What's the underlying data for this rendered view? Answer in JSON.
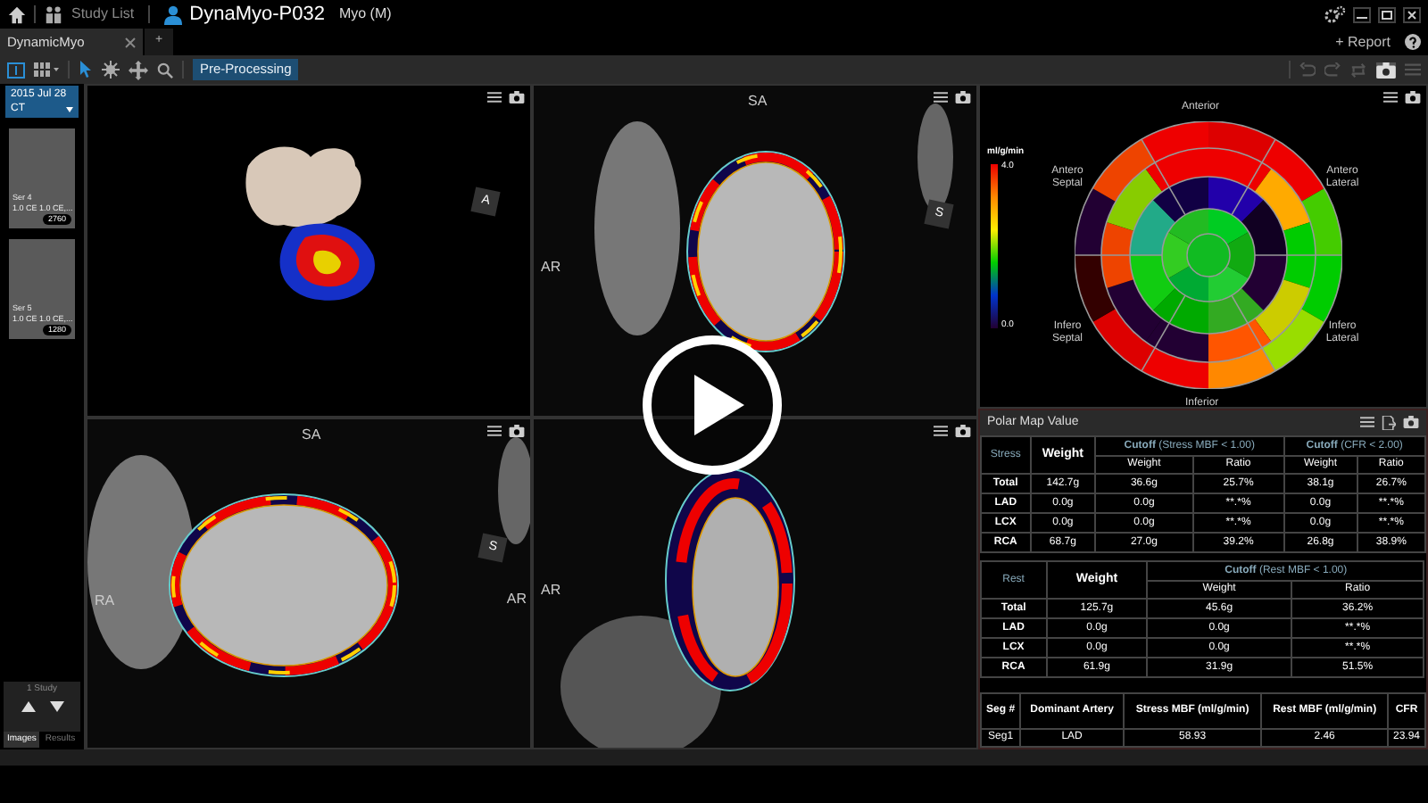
{
  "app_bar": {
    "study_list": "Study List",
    "patient_name": "DynaMyo-P032",
    "patient_info": "Myo (M)",
    "report": "+ Report"
  },
  "tabs": [
    {
      "label": "DynamicMyo",
      "selected": true
    }
  ],
  "new_tab": "+",
  "toolbar": {
    "mode_button": "Pre-Processing"
  },
  "sidebar": {
    "study": {
      "date": "2015 Jul 28",
      "modality": "CT"
    },
    "series": [
      {
        "name": "Ser 4",
        "description": "1.0 CE 1.0 CE,...",
        "count": "2760"
      },
      {
        "name": "Ser 5",
        "description": "1.0 CE 1.0 CE,...",
        "count": "1280"
      }
    ],
    "study_count": "1 Study",
    "tabs": [
      {
        "label": "Images",
        "selected": true
      },
      {
        "label": "Results",
        "selected": false
      }
    ]
  },
  "viewports": [
    {
      "kind": "volume",
      "cube_label": "A"
    },
    {
      "kind": "slice",
      "top_label": "SA",
      "left_label": "AR",
      "cube_label": "S"
    },
    {
      "kind": "slice",
      "top_label": "SA",
      "left_label": "RA",
      "right_label": "AR",
      "cube_label": "S"
    },
    {
      "kind": "long_axis",
      "left_label": "AR"
    }
  ],
  "polar_map": {
    "unit": "ml/g/min",
    "max": "4.0",
    "min": "0.0",
    "anterior": "Anterior",
    "antero_septal": "Antero Septal",
    "antero_lateral": "Antero Lateral",
    "infero_septal": "Infero Septal",
    "infero_lateral": "Infero Lateral",
    "inferior": "Inferior"
  },
  "polar_map_value": {
    "title": "Polar Map Value",
    "stress": {
      "heading": "Stress",
      "weight": "Weight",
      "cutoffs": [
        "**Cutoff** (Stress MBF < 1.00)",
        "**Cutoff** (CFR < 2.00)"
      ],
      "subheads": [
        "Weight",
        "Ratio",
        "Weight",
        "Ratio"
      ],
      "rows": [
        [
          "Total",
          "142.7g",
          "36.6g",
          "25.7%",
          "38.1g",
          "26.7%"
        ],
        [
          "LAD",
          "0.0g",
          "0.0g",
          "**.*%",
          "0.0g",
          "**.*%"
        ],
        [
          "LCX",
          "0.0g",
          "0.0g",
          "**.*%",
          "0.0g",
          "**.*%"
        ],
        [
          "RCA",
          "68.7g",
          "27.0g",
          "39.2%",
          "26.8g",
          "38.9%"
        ]
      ]
    },
    "rest": {
      "heading": "Rest",
      "weight": "Weight",
      "cutoffs": [
        "**Cutoff** (Rest MBF < 1.00)"
      ],
      "subheads": [
        "Weight",
        "Ratio"
      ],
      "rows": [
        [
          "Total",
          "125.7g",
          "45.6g",
          "36.2%"
        ],
        [
          "LAD",
          "0.0g",
          "0.0g",
          "**.*%"
        ],
        [
          "LCX",
          "0.0g",
          "0.0g",
          "**.*%"
        ],
        [
          "RCA",
          "61.9g",
          "31.9g",
          "51.5%"
        ]
      ]
    },
    "segments": {
      "columns": [
        "Seg #",
        "Dominant Artery",
        "Stress MBF (ml/g/min)",
        "Rest MBF (ml/g/min)",
        "CFR"
      ],
      "rows": [
        [
          "Seg1",
          "LAD",
          "58.93",
          "2.46",
          "23.94"
        ]
      ]
    }
  }
}
